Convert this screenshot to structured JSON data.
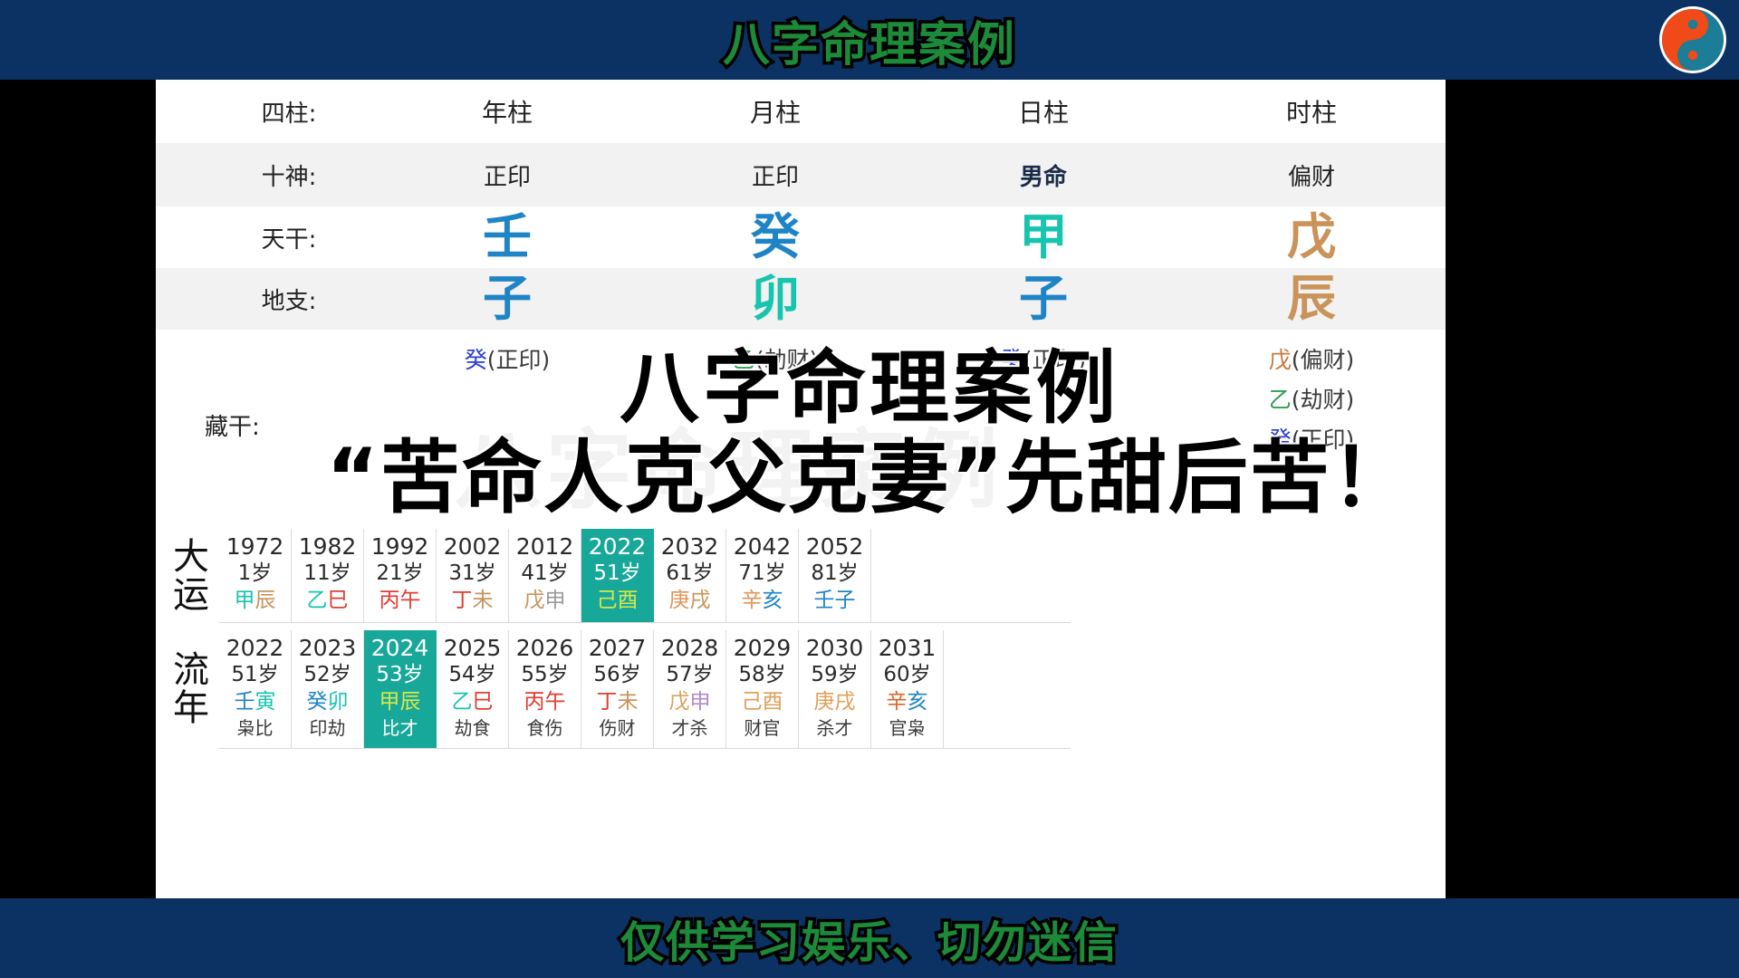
{
  "header": {
    "title": "八字命理案例",
    "title_color": "#1d8a3a",
    "banner_color": "#0b3263",
    "logo": "taiji-yinyang-logo",
    "logo_colors": {
      "left": "#f04a18",
      "right": "#1b7d96"
    }
  },
  "footer": {
    "text": "仅供学习娱乐、切勿迷信"
  },
  "overlay": {
    "line1": "八字命理案例",
    "line2": "“苦命人克父克妻”先甜后苦！"
  },
  "watermark": "八字命理案例",
  "chart": {
    "row_labels": {
      "pillars": "四柱:",
      "ten_gods": "十神:",
      "heavenly_stems": "天干:",
      "earthly_branches": "地支:",
      "hidden_stems": "藏干:"
    },
    "columns": [
      {
        "head": "年柱",
        "ten_god": "正印",
        "ten_god_bold": false,
        "stem": "壬",
        "stem_color": "#1f84c6",
        "branch": "子",
        "branch_color": "#1f84c6",
        "hidden": [
          {
            "stem": "癸",
            "color": "#2b3fd4",
            "god": "正印"
          }
        ]
      },
      {
        "head": "月柱",
        "ten_god": "正印",
        "ten_god_bold": false,
        "stem": "癸",
        "stem_color": "#1f84c6",
        "branch": "卯",
        "branch_color": "#17c4ae",
        "hidden": [
          {
            "stem": "乙",
            "color": "#2e9e52",
            "god": "劫财"
          }
        ]
      },
      {
        "head": "日柱",
        "ten_god": "男命",
        "ten_god_bold": true,
        "stem": "甲",
        "stem_color": "#17c4ae",
        "branch": "子",
        "branch_color": "#1f84c6",
        "hidden": [
          {
            "stem": "癸",
            "color": "#2b3fd4",
            "god": "正印"
          }
        ]
      },
      {
        "head": "时柱",
        "ten_god": "偏财",
        "ten_god_bold": false,
        "stem": "戊",
        "stem_color": "#c9935a",
        "branch": "辰",
        "branch_color": "#c9935a",
        "hidden": [
          {
            "stem": "戊",
            "color": "#c9783a",
            "god": "偏财"
          },
          {
            "stem": "乙",
            "color": "#2e9e52",
            "god": "劫财"
          },
          {
            "stem": "癸",
            "color": "#2b3fd4",
            "god": "正印"
          }
        ]
      }
    ]
  },
  "chart_data": {
    "type": "table",
    "title": "八字命理案例",
    "dayun": {
      "label": "大运",
      "selected_index": 5,
      "cells": [
        {
          "year": "1972",
          "age": "1岁",
          "gz": "甲辰",
          "gz_colors": [
            "#17c4ae",
            "#c9935a"
          ]
        },
        {
          "year": "1982",
          "age": "11岁",
          "gz": "乙巳",
          "gz_colors": [
            "#17c4ae",
            "#e03c31"
          ]
        },
        {
          "year": "1992",
          "age": "21岁",
          "gz": "丙午",
          "gz_colors": [
            "#e03c31",
            "#e03c31"
          ]
        },
        {
          "year": "2002",
          "age": "31岁",
          "gz": "丁未",
          "gz_colors": [
            "#e03c31",
            "#c9935a"
          ]
        },
        {
          "year": "2012",
          "age": "41岁",
          "gz": "戊申",
          "gz_colors": [
            "#c9935a",
            "#9a9a9a"
          ]
        },
        {
          "year": "2022",
          "age": "51岁",
          "gz": "己酉",
          "gz_colors": [
            "#d7e84a",
            "#d7e84a"
          ]
        },
        {
          "year": "2032",
          "age": "61岁",
          "gz": "庚戌",
          "gz_colors": [
            "#e0955a",
            "#c9935a"
          ]
        },
        {
          "year": "2042",
          "age": "71岁",
          "gz": "辛亥",
          "gz_colors": [
            "#e0955a",
            "#1f84c6"
          ]
        },
        {
          "year": "2052",
          "age": "81岁",
          "gz": "壬子",
          "gz_colors": [
            "#1f84c6",
            "#1f84c6"
          ]
        }
      ]
    },
    "liunian": {
      "label": "流年",
      "selected_index": 2,
      "cells": [
        {
          "year": "2022",
          "age": "51岁",
          "gz": "壬寅",
          "gz_colors": [
            "#1f84c6",
            "#17c4ae"
          ],
          "ten": "枭比"
        },
        {
          "year": "2023",
          "age": "52岁",
          "gz": "癸卯",
          "gz_colors": [
            "#1f84c6",
            "#17c4ae"
          ],
          "ten": "印劫"
        },
        {
          "year": "2024",
          "age": "53岁",
          "gz": "甲辰",
          "gz_colors": [
            "#d7e84a",
            "#d7e84a"
          ],
          "ten": "比才"
        },
        {
          "year": "2025",
          "age": "54岁",
          "gz": "乙巳",
          "gz_colors": [
            "#17c4ae",
            "#e03c31"
          ],
          "ten": "劫食"
        },
        {
          "year": "2026",
          "age": "55岁",
          "gz": "丙午",
          "gz_colors": [
            "#e03c31",
            "#e03c31"
          ],
          "ten": "食伤"
        },
        {
          "year": "2027",
          "age": "56岁",
          "gz": "丁未",
          "gz_colors": [
            "#e03c31",
            "#c9935a"
          ],
          "ten": "伤财"
        },
        {
          "year": "2028",
          "age": "57岁",
          "gz": "戊申",
          "gz_colors": [
            "#e0a05a",
            "#b08cc9"
          ],
          "ten": "才杀"
        },
        {
          "year": "2029",
          "age": "58岁",
          "gz": "己酉",
          "gz_colors": [
            "#e0a05a",
            "#e0a05a"
          ],
          "ten": "财官"
        },
        {
          "year": "2030",
          "age": "59岁",
          "gz": "庚戌",
          "gz_colors": [
            "#e0a05a",
            "#e0a05a"
          ],
          "ten": "杀才"
        },
        {
          "year": "2031",
          "age": "60岁",
          "gz": "辛亥",
          "gz_colors": [
            "#e0632a",
            "#1f84c6"
          ],
          "ten": "官枭"
        }
      ]
    }
  }
}
